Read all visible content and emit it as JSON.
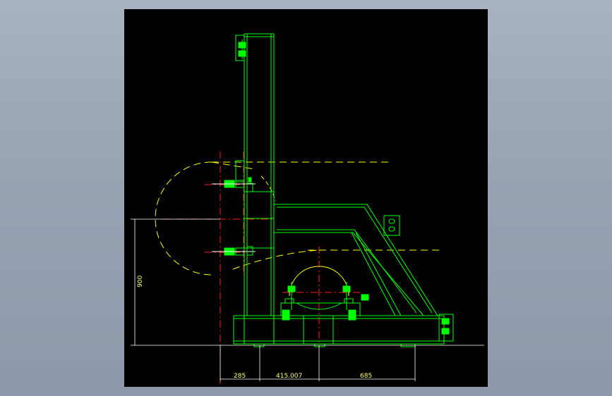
{
  "drawing": {
    "colors": {
      "background": "#000000",
      "frame": "#00ff00",
      "centerline": "#ff2020",
      "hidden": "#ffff00",
      "dimension": "#ffff66",
      "fastener": "#ffffff"
    },
    "dimensions": {
      "height": "900",
      "d1": "285",
      "d2": "415.007",
      "d3": "685"
    }
  }
}
